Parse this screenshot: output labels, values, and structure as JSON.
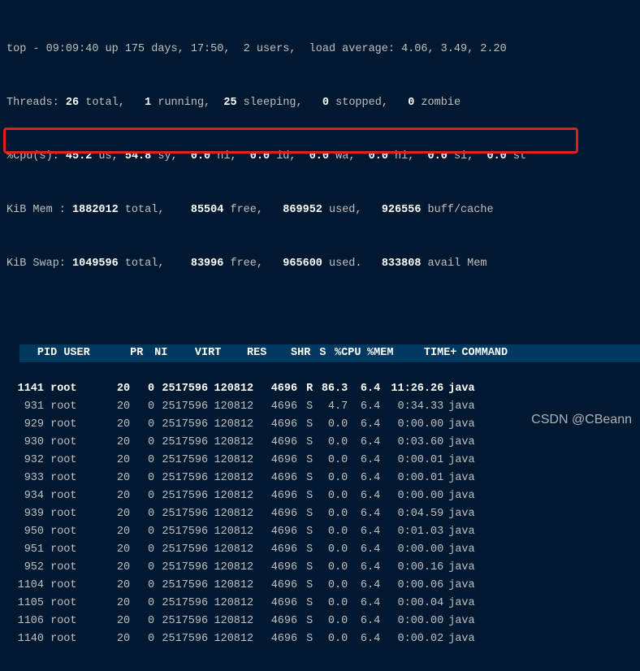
{
  "summary": {
    "line1": "top - 09:09:40 up 175 days, 17:50,  2 users,  load average: 4.06, 3.49, 2.20",
    "line2_pre": "Threads: ",
    "line2_vals": [
      "26",
      "1",
      "25",
      "0",
      "0"
    ],
    "line2_lbls": [
      " total,   ",
      " running,  ",
      " sleeping,   ",
      " stopped,   ",
      " zombie"
    ],
    "line3_pre": "%Cpu(s): ",
    "line3_vals": [
      "45.2",
      "54.8",
      "0.0",
      "0.0",
      "0.0",
      "0.0",
      "0.0",
      "0.0"
    ],
    "line3_lbls": [
      " us, ",
      " sy,  ",
      " ni,  ",
      " id,  ",
      " wa,  ",
      " hi,  ",
      " si,  ",
      " st"
    ],
    "line4_pre": "KiB Mem : ",
    "line4_vals": [
      "1882012",
      "85504",
      "869952",
      "926556"
    ],
    "line4_lbls": [
      " total,    ",
      " free,   ",
      " used,   ",
      " buff/cache"
    ],
    "line5_pre": "KiB Swap: ",
    "line5_vals": [
      "1049596",
      "83996",
      "965600",
      "833808"
    ],
    "line5_lbls": [
      " total,    ",
      " free,   ",
      " used.   ",
      " avail Mem"
    ]
  },
  "columns": {
    "pid": "PID",
    "user": "USER",
    "pr": "PR",
    "ni": "NI",
    "virt": "VIRT",
    "res": "RES",
    "shr": "SHR",
    "s": "S",
    "cpu": "%CPU",
    "mem": "%MEM",
    "time": "TIME+",
    "cmd": "COMMAND"
  },
  "rows": [
    {
      "pid": "1141",
      "user": "root",
      "pr": "20",
      "ni": "0",
      "virt": "2517596",
      "res": "120812",
      "shr": "4696",
      "s": "R",
      "cpu": "86.3",
      "mem": "6.4",
      "time": "11:26.26",
      "cmd": "java",
      "sel": true
    },
    {
      "pid": "931",
      "user": "root",
      "pr": "20",
      "ni": "0",
      "virt": "2517596",
      "res": "120812",
      "shr": "4696",
      "s": "S",
      "cpu": "4.7",
      "mem": "6.4",
      "time": "0:34.33",
      "cmd": "java"
    },
    {
      "pid": "929",
      "user": "root",
      "pr": "20",
      "ni": "0",
      "virt": "2517596",
      "res": "120812",
      "shr": "4696",
      "s": "S",
      "cpu": "0.0",
      "mem": "6.4",
      "time": "0:00.00",
      "cmd": "java"
    },
    {
      "pid": "930",
      "user": "root",
      "pr": "20",
      "ni": "0",
      "virt": "2517596",
      "res": "120812",
      "shr": "4696",
      "s": "S",
      "cpu": "0.0",
      "mem": "6.4",
      "time": "0:03.60",
      "cmd": "java"
    },
    {
      "pid": "932",
      "user": "root",
      "pr": "20",
      "ni": "0",
      "virt": "2517596",
      "res": "120812",
      "shr": "4696",
      "s": "S",
      "cpu": "0.0",
      "mem": "6.4",
      "time": "0:00.01",
      "cmd": "java"
    },
    {
      "pid": "933",
      "user": "root",
      "pr": "20",
      "ni": "0",
      "virt": "2517596",
      "res": "120812",
      "shr": "4696",
      "s": "S",
      "cpu": "0.0",
      "mem": "6.4",
      "time": "0:00.01",
      "cmd": "java"
    },
    {
      "pid": "934",
      "user": "root",
      "pr": "20",
      "ni": "0",
      "virt": "2517596",
      "res": "120812",
      "shr": "4696",
      "s": "S",
      "cpu": "0.0",
      "mem": "6.4",
      "time": "0:00.00",
      "cmd": "java"
    },
    {
      "pid": "939",
      "user": "root",
      "pr": "20",
      "ni": "0",
      "virt": "2517596",
      "res": "120812",
      "shr": "4696",
      "s": "S",
      "cpu": "0.0",
      "mem": "6.4",
      "time": "0:04.59",
      "cmd": "java"
    },
    {
      "pid": "950",
      "user": "root",
      "pr": "20",
      "ni": "0",
      "virt": "2517596",
      "res": "120812",
      "shr": "4696",
      "s": "S",
      "cpu": "0.0",
      "mem": "6.4",
      "time": "0:01.03",
      "cmd": "java"
    },
    {
      "pid": "951",
      "user": "root",
      "pr": "20",
      "ni": "0",
      "virt": "2517596",
      "res": "120812",
      "shr": "4696",
      "s": "S",
      "cpu": "0.0",
      "mem": "6.4",
      "time": "0:00.00",
      "cmd": "java"
    },
    {
      "pid": "952",
      "user": "root",
      "pr": "20",
      "ni": "0",
      "virt": "2517596",
      "res": "120812",
      "shr": "4696",
      "s": "S",
      "cpu": "0.0",
      "mem": "6.4",
      "time": "0:00.16",
      "cmd": "java"
    },
    {
      "pid": "1104",
      "user": "root",
      "pr": "20",
      "ni": "0",
      "virt": "2517596",
      "res": "120812",
      "shr": "4696",
      "s": "S",
      "cpu": "0.0",
      "mem": "6.4",
      "time": "0:00.06",
      "cmd": "java"
    },
    {
      "pid": "1105",
      "user": "root",
      "pr": "20",
      "ni": "0",
      "virt": "2517596",
      "res": "120812",
      "shr": "4696",
      "s": "S",
      "cpu": "0.0",
      "mem": "6.4",
      "time": "0:00.04",
      "cmd": "java"
    },
    {
      "pid": "1106",
      "user": "root",
      "pr": "20",
      "ni": "0",
      "virt": "2517596",
      "res": "120812",
      "shr": "4696",
      "s": "S",
      "cpu": "0.0",
      "mem": "6.4",
      "time": "0:00.00",
      "cmd": "java"
    },
    {
      "pid": "1140",
      "user": "root",
      "pr": "20",
      "ni": "0",
      "virt": "2517596",
      "res": "120812",
      "shr": "4696",
      "s": "S",
      "cpu": "0.0",
      "mem": "6.4",
      "time": "0:00.02",
      "cmd": "java"
    }
  ],
  "watermark": "CSDN @CBeann"
}
